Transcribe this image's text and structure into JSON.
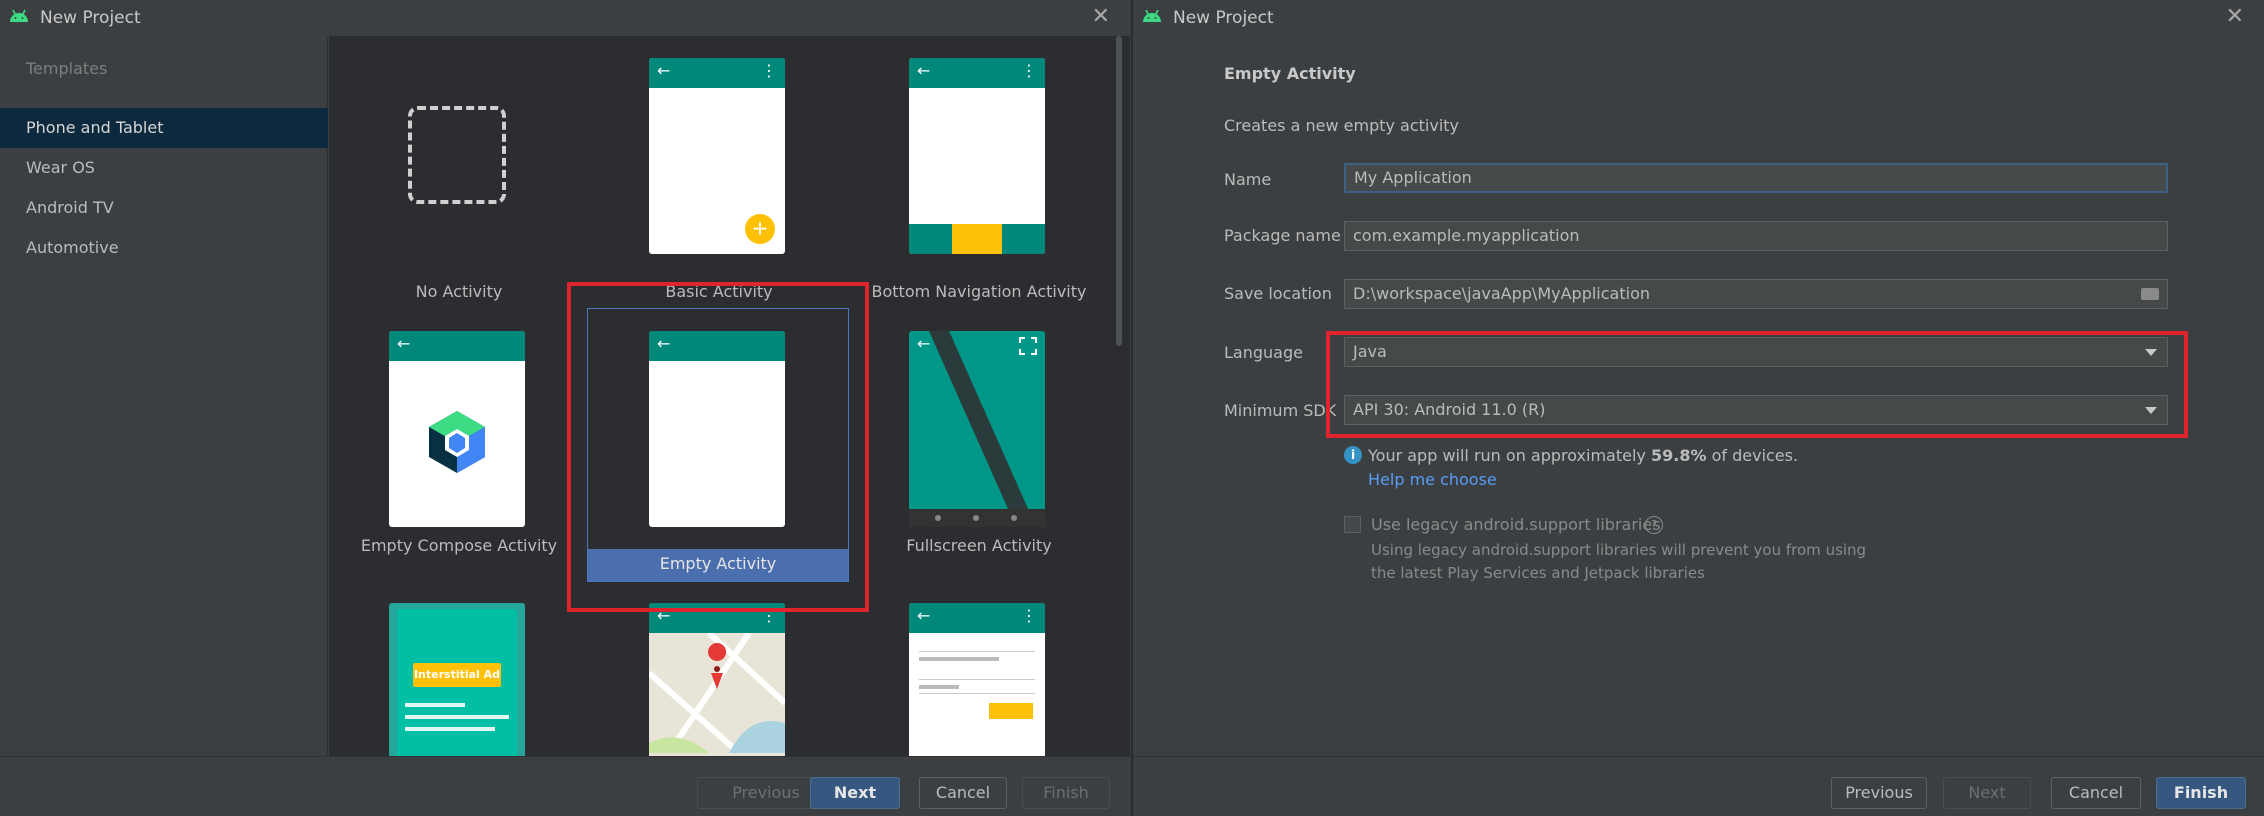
{
  "left": {
    "title": "New Project",
    "sidebar": {
      "header": "Templates",
      "items": [
        "Phone and Tablet",
        "Wear OS",
        "Android TV",
        "Automotive"
      ]
    },
    "templates": [
      {
        "label": "No Activity"
      },
      {
        "label": "Basic Activity"
      },
      {
        "label": "Bottom Navigation Activity"
      },
      {
        "label": "Empty Compose Activity"
      },
      {
        "label": "Empty Activity"
      },
      {
        "label": "Fullscreen Activity"
      }
    ],
    "thumb_text": {
      "interstitial": "Interstitial Ad"
    },
    "buttons": {
      "previous": "Previous",
      "next": "Next",
      "cancel": "Cancel",
      "finish": "Finish"
    }
  },
  "right": {
    "title": "New Project",
    "heading": "Empty Activity",
    "description": "Creates a new empty activity",
    "fields": {
      "name": {
        "label": "Name",
        "value": "My Application"
      },
      "package": {
        "label": "Package name",
        "value": "com.example.myapplication"
      },
      "save": {
        "label": "Save location",
        "value": "D:\\workspace\\javaApp\\MyApplication"
      },
      "language": {
        "label": "Language",
        "value": "Java"
      },
      "min_sdk": {
        "label": "Minimum SDK",
        "value": "API 30: Android 11.0 (R)"
      }
    },
    "info": {
      "prefix": "Your app will run on approximately ",
      "percent": "59.8%",
      "suffix": " of devices.",
      "link": "Help me choose"
    },
    "legacy": {
      "label": "Use legacy android.support libraries",
      "note1": "Using legacy android.support libraries will prevent you from using",
      "note2": "the latest Play Services and Jetpack libraries"
    },
    "buttons": {
      "previous": "Previous",
      "next": "Next",
      "cancel": "Cancel",
      "finish": "Finish"
    }
  },
  "colors": {
    "accent": "#00897b",
    "selection": "#0d293e",
    "primary_button": "#365880",
    "highlight": "#e0242e",
    "link": "#589df6"
  }
}
